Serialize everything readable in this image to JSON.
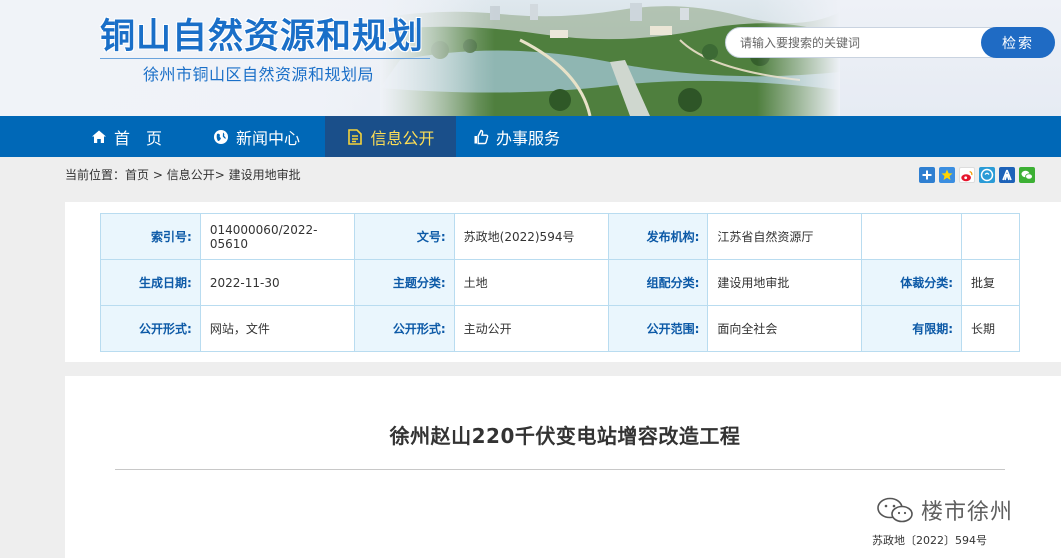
{
  "header": {
    "title": "铜山自然资源和规划",
    "subtitle": "徐州市铜山区自然资源和规划局",
    "search": {
      "placeholder": "请输入要搜索的关键词",
      "button": "检索"
    }
  },
  "nav": [
    {
      "label": "首　页",
      "icon": "home-icon"
    },
    {
      "label": "新闻中心",
      "icon": "globe-icon"
    },
    {
      "label": "信息公开",
      "icon": "document-icon",
      "active": true
    },
    {
      "label": "办事服务",
      "icon": "thumbs-up-icon"
    }
  ],
  "breadcrumb": {
    "prefix": "当前位置：",
    "items": [
      "首页",
      "信息公开",
      "建设用地审批"
    ],
    "sep1": " > ",
    "sep2": "> "
  },
  "share_icons": [
    "plus-icon",
    "qzone-icon",
    "weibo-icon",
    "qq-icon",
    "renren-icon",
    "wechat-icon"
  ],
  "meta": {
    "rows": [
      [
        {
          "key": "索引号:",
          "value": "014000060/2022-05610"
        },
        {
          "key": "文号:",
          "value": "苏政地(2022)594号"
        },
        {
          "key": "发布机构:",
          "value": "江苏省自然资源厅"
        },
        {
          "key": "",
          "value": ""
        }
      ],
      [
        {
          "key": "生成日期:",
          "value": "2022-11-30"
        },
        {
          "key": "主题分类:",
          "value": "土地"
        },
        {
          "key": "组配分类:",
          "value": "建设用地审批"
        },
        {
          "key": "体裁分类:",
          "value": "批复"
        }
      ],
      [
        {
          "key": "公开形式:",
          "value": "网站，文件"
        },
        {
          "key": "公开形式:",
          "value": "主动公开"
        },
        {
          "key": "公开范围:",
          "value": "面向全社会"
        },
        {
          "key": "有限期:",
          "value": "长期"
        }
      ]
    ]
  },
  "article": {
    "title": "徐州赵山220千伏变电站增容改造工程",
    "doc_number": "苏政地〔2022〕594号",
    "watermark": "楼市徐州"
  },
  "colors": {
    "brand_blue": "#0068b7",
    "nav_active": "#1a4f8a",
    "key_text": "#0d5aa7"
  }
}
